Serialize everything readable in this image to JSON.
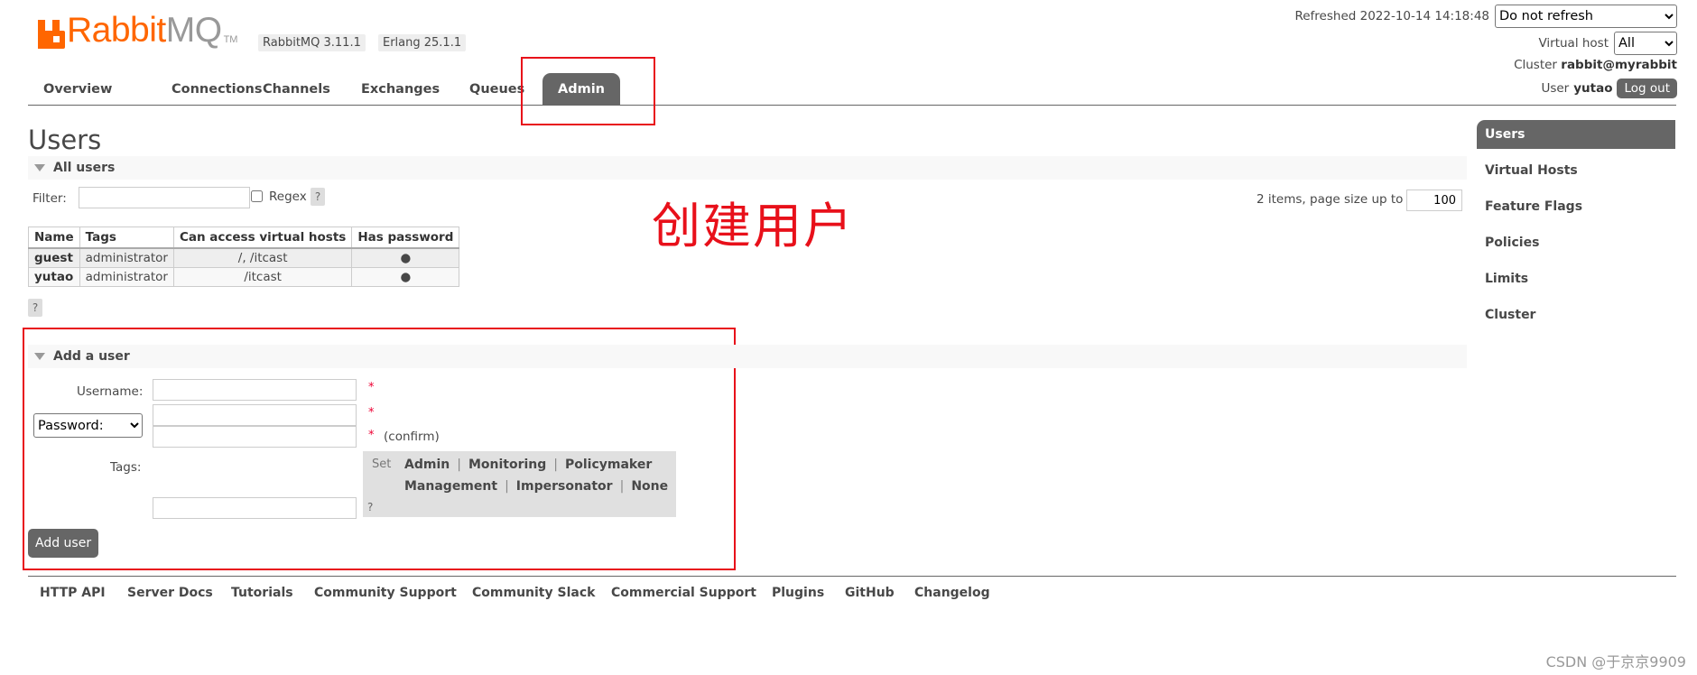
{
  "header": {
    "logo_rabbit": "Rabbit",
    "logo_mq": "MQ",
    "logo_tm": "TM",
    "rabbitmq_version": "RabbitMQ 3.11.1",
    "erlang_version": "Erlang 25.1.1",
    "refreshed_text": "Refreshed 2022-10-14 14:18:48",
    "refresh_option": "Do not refresh",
    "virtual_host_label": "Virtual host",
    "virtual_host_value": "All",
    "cluster_label": "Cluster",
    "cluster_value": "rabbit@myrabbit",
    "user_label": "User",
    "user_value": "yutao",
    "logout_label": "Log out"
  },
  "tabs": [
    {
      "label": "Overview"
    },
    {
      "label": "Connections"
    },
    {
      "label": "Channels"
    },
    {
      "label": "Exchanges"
    },
    {
      "label": "Queues"
    },
    {
      "label": "Admin",
      "active": true
    }
  ],
  "sidebar": {
    "items": [
      {
        "label": "Users",
        "active": true
      },
      {
        "label": "Virtual Hosts"
      },
      {
        "label": "Feature Flags"
      },
      {
        "label": "Policies"
      },
      {
        "label": "Limits"
      },
      {
        "label": "Cluster"
      }
    ]
  },
  "page_title": "Users",
  "all_users": {
    "heading": "All users",
    "filter_label": "Filter:",
    "filter_value": "",
    "regex_label": "Regex",
    "help_label": "?",
    "items_text": "2 items, page size up to",
    "page_size": "100",
    "columns": [
      "Name",
      "Tags",
      "Can access virtual hosts",
      "Has password"
    ],
    "rows": [
      {
        "name": "guest",
        "tags": "administrator",
        "vhosts": "/, /itcast",
        "has_password": "●"
      },
      {
        "name": "yutao",
        "tags": "administrator",
        "vhosts": "/itcast",
        "has_password": "●"
      }
    ]
  },
  "annotation": "创建用户",
  "add_user": {
    "heading": "Add a user",
    "username_label": "Username:",
    "password_option": "Password:",
    "required_mark": "*",
    "confirm_text": "(confirm)",
    "tags_label": "Tags:",
    "set_label": "Set",
    "tag_options": [
      "Admin",
      "Monitoring",
      "Policymaker",
      "Management",
      "Impersonator",
      "None"
    ],
    "help_label": "?",
    "submit_label": "Add user"
  },
  "footer": {
    "links": [
      "HTTP API",
      "Server Docs",
      "Tutorials",
      "Community Support",
      "Community Slack",
      "Commercial Support",
      "Plugins",
      "GitHub",
      "Changelog"
    ]
  },
  "watermark": "CSDN @于京京9909",
  "colors": {
    "brand_orange": "#ff6600",
    "nav_active": "#666666",
    "annotation_red": "#e8101a"
  }
}
